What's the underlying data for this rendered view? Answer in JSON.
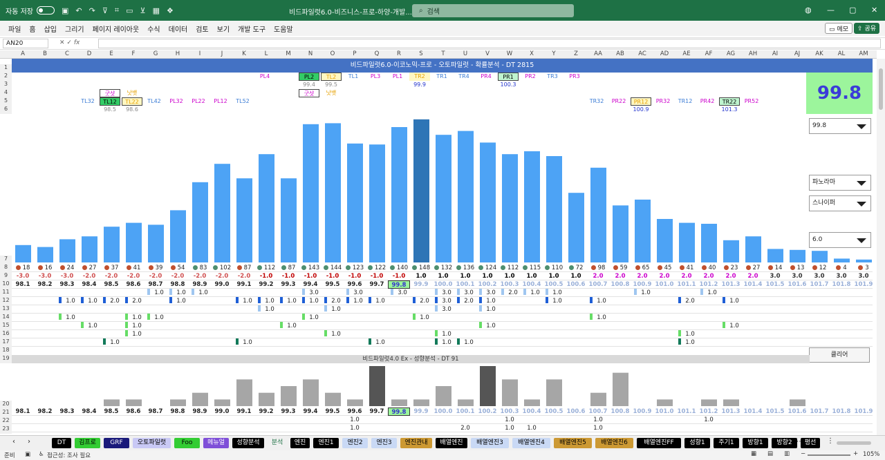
{
  "titlebar": {
    "autosave_label": "자동 저장",
    "autosave_state": "끔",
    "doc_title": "비드파일럿6.0-비즈니스-프로-하양-개발...",
    "search_placeholder": "검색",
    "colors": {
      "bg": "#1e7145"
    }
  },
  "menu": {
    "items": [
      "파일",
      "홈",
      "삽입",
      "그리기",
      "페이지 레이아웃",
      "수식",
      "데이터",
      "검토",
      "보기",
      "개발 도구",
      "도움말"
    ],
    "memo_label": "메모",
    "share_label": "공유"
  },
  "formula_bar": {
    "name_box": "AN20",
    "fx_label": "fx",
    "formula": ""
  },
  "columns": [
    "A",
    "B",
    "C",
    "D",
    "E",
    "F",
    "G",
    "H",
    "I",
    "J",
    "K",
    "L",
    "M",
    "N",
    "O",
    "P",
    "Q",
    "R",
    "S",
    "T",
    "U",
    "V",
    "W",
    "X",
    "Y",
    "Z",
    "AA",
    "AB",
    "AC",
    "AD",
    "AE",
    "AF",
    "AG",
    "AH",
    "AI",
    "AJ",
    "AK",
    "AL",
    "AM"
  ],
  "rows_top": [
    "1",
    "2",
    "3",
    "4",
    "5",
    "6",
    "7"
  ],
  "rows_grid": [
    "8",
    "9",
    "10",
    "11",
    "12",
    "13",
    "14",
    "15",
    "16",
    "17",
    "18",
    "19",
    "20",
    "21",
    "22",
    "23"
  ],
  "banner1": "비드파일럿6.0-이코노믹-프로 - 오토파일럿 - 확률분석 - DT 2815",
  "big_value": "99.8",
  "tiles": {
    "row2": [
      {
        "col": 11,
        "label": "PL4",
        "color": "#cc00cc"
      },
      {
        "col": 13,
        "label": "PL2",
        "color": "#000",
        "bg": "#33cc66",
        "box": true
      },
      {
        "col": 14,
        "label": "TL2",
        "color": "#e6a000",
        "bg": "#fff7c2",
        "box": true
      },
      {
        "col": 15,
        "label": "TL1",
        "color": "#3a7bd5"
      },
      {
        "col": 16,
        "label": "PL3",
        "color": "#cc00cc"
      },
      {
        "col": 17,
        "label": "PL1",
        "color": "#cc00cc"
      },
      {
        "col": 18,
        "label": "TR2",
        "color": "#e6a000",
        "bg": "#fff7c2"
      },
      {
        "col": 19,
        "label": "TR1",
        "color": "#3a7bd5"
      },
      {
        "col": 20,
        "label": "TR4",
        "color": "#3a7bd5"
      },
      {
        "col": 21,
        "label": "PR4",
        "color": "#cc00cc"
      },
      {
        "col": 22,
        "label": "PR1",
        "color": "#000",
        "bg": "#bff5cf",
        "box": true
      },
      {
        "col": 23,
        "label": "PR2",
        "color": "#cc00cc"
      },
      {
        "col": 24,
        "label": "TR3",
        "color": "#3a7bd5"
      },
      {
        "col": 25,
        "label": "PR3",
        "color": "#cc00cc"
      }
    ],
    "row3": [
      {
        "col": 13,
        "label": "99.4",
        "color": "#888"
      },
      {
        "col": 14,
        "label": "99.5",
        "color": "#888"
      },
      {
        "col": 18,
        "label": "99.9",
        "color": "#2233cc"
      },
      {
        "col": 22,
        "label": "100.3",
        "color": "#2233cc"
      }
    ],
    "row4": [
      {
        "col": 4,
        "label": "굿샷",
        "color": "#cc00cc",
        "box": true
      },
      {
        "col": 5,
        "label": "낫뱃",
        "color": "#e6a000"
      },
      {
        "col": 13,
        "label": "굿샷",
        "color": "#cc00cc",
        "box": true
      },
      {
        "col": 14,
        "label": "낫뱃",
        "color": "#e6a000"
      }
    ],
    "row5": [
      {
        "col": 3,
        "label": "TL32",
        "color": "#3a7bd5"
      },
      {
        "col": 4,
        "label": "TL12",
        "color": "#000",
        "bg": "#33cc66",
        "box": true
      },
      {
        "col": 5,
        "label": "TL22",
        "color": "#e6a000",
        "bg": "#fff7c2",
        "box": true
      },
      {
        "col": 6,
        "label": "TL42",
        "color": "#3a7bd5"
      },
      {
        "col": 7,
        "label": "PL32",
        "color": "#cc00cc"
      },
      {
        "col": 8,
        "label": "PL22",
        "color": "#cc00cc"
      },
      {
        "col": 9,
        "label": "PL12",
        "color": "#cc00cc"
      },
      {
        "col": 10,
        "label": "TL52",
        "color": "#3a7bd5"
      },
      {
        "col": 26,
        "label": "TR32",
        "color": "#3a7bd5"
      },
      {
        "col": 27,
        "label": "PR22",
        "color": "#cc00cc"
      },
      {
        "col": 28,
        "label": "PR12",
        "color": "#e6a000",
        "bg": "#fff7c2",
        "box": true
      },
      {
        "col": 29,
        "label": "PR32",
        "color": "#cc00cc"
      },
      {
        "col": 30,
        "label": "TR12",
        "color": "#3a7bd5"
      },
      {
        "col": 31,
        "label": "PR42",
        "color": "#cc00cc"
      },
      {
        "col": 32,
        "label": "TR22",
        "color": "#000",
        "bg": "#bff5cf",
        "box": true
      },
      {
        "col": 33,
        "label": "PR52",
        "color": "#cc00cc"
      }
    ],
    "row6": [
      {
        "col": 4,
        "label": "98.5",
        "color": "#888"
      },
      {
        "col": 5,
        "label": "98.6",
        "color": "#888"
      },
      {
        "col": 28,
        "label": "100.9",
        "color": "#2233cc"
      },
      {
        "col": 32,
        "label": "101.3",
        "color": "#2233cc"
      }
    ]
  },
  "dropdowns": [
    "99.8",
    "파노라마",
    "스나이퍼",
    "6.0"
  ],
  "chart_data": [
    {
      "type": "bar",
      "categories": [
        "98.1",
        "98.2",
        "98.3",
        "98.4",
        "98.5",
        "98.6",
        "98.7",
        "98.8",
        "98.9",
        "99.0",
        "99.1",
        "99.2",
        "99.3",
        "99.4",
        "99.5",
        "99.6",
        "99.7",
        "99.8",
        "99.9",
        "100.0",
        "100.1",
        "100.2",
        "100.3",
        "100.4",
        "100.5",
        "100.6",
        "100.7",
        "100.8",
        "100.9",
        "101.0",
        "101.1",
        "101.2",
        "101.3",
        "101.4",
        "101.5",
        "101.6",
        "101.7",
        "101.8",
        "101.9"
      ],
      "values": [
        18,
        16,
        24,
        27,
        37,
        41,
        39,
        54,
        83,
        102,
        87,
        112,
        87,
        143,
        144,
        123,
        122,
        140,
        148,
        132,
        136,
        124,
        112,
        115,
        110,
        72,
        98,
        59,
        65,
        45,
        41,
        40,
        23,
        27,
        14,
        13,
        12,
        4,
        3
      ],
      "highlight_index": 18,
      "ylim": [
        0,
        150
      ],
      "colors": {
        "bar": "#4da3f5",
        "highlight": "#2e75b6"
      }
    },
    {
      "type": "bar",
      "title": "비드파일럿4.0 Ex - 성향분석 - DT 91",
      "categories": [
        "98.1",
        "98.2",
        "98.3",
        "98.4",
        "98.5",
        "98.6",
        "98.7",
        "98.8",
        "98.9",
        "99.0",
        "99.1",
        "99.2",
        "99.3",
        "99.4",
        "99.5",
        "99.6",
        "99.7",
        "99.8",
        "99.9",
        "100.0",
        "100.1",
        "100.2",
        "100.3",
        "100.4",
        "100.5",
        "100.6",
        "100.7",
        "100.8",
        "100.9",
        "101.0",
        "101.1",
        "101.2",
        "101.3",
        "101.4",
        "101.5",
        "101.6",
        "101.7",
        "101.8",
        "101.9"
      ],
      "values": [
        0,
        0,
        0,
        0,
        1,
        1,
        0,
        1,
        2,
        1,
        4,
        2,
        3,
        4,
        2,
        1,
        6,
        1,
        1,
        3,
        1,
        6,
        4,
        1,
        4,
        0,
        2,
        5,
        0,
        1,
        0,
        1,
        1,
        0,
        0,
        1,
        0,
        0,
        0
      ],
      "dark_indices": [
        16,
        21
      ],
      "ylim": [
        0,
        6
      ],
      "colors": {
        "bar": "#a6a6a6",
        "dark": "#555555"
      }
    }
  ],
  "row8_counts": [
    "18",
    "16",
    "24",
    "27",
    "37",
    "41",
    "39",
    "54",
    "83",
    "102",
    "87",
    "112",
    "87",
    "143",
    "144",
    "123",
    "122",
    "140",
    "148",
    "132",
    "136",
    "124",
    "112",
    "115",
    "110",
    "72",
    "98",
    "59",
    "65",
    "45",
    "41",
    "40",
    "23",
    "27",
    "14",
    "13",
    "12",
    "4",
    "3"
  ],
  "row8_dot_colors": [
    "#c0502f",
    "#c0502f",
    "#c0502f",
    "#c0502f",
    "#c0502f",
    "#c0502f",
    "#c0502f",
    "#c0502f",
    "#4f8f6f",
    "#4f8f6f",
    "#c0502f",
    "#4f8f6f",
    "#4f8f6f",
    "#4f8f6f",
    "#4f8f6f",
    "#4f8f6f",
    "#4f8f6f",
    "#4f8f6f",
    "#4f8f6f",
    "#4f8f6f",
    "#4f8f6f",
    "#4f8f6f",
    "#4f8f6f",
    "#4f8f6f",
    "#4f8f6f",
    "#4f8f6f",
    "#c0502f",
    "#c0502f",
    "#c0502f",
    "#c0502f",
    "#c0502f",
    "#c0502f",
    "#c0502f",
    "#c0502f",
    "#c0502f",
    "#c0502f",
    "#c0502f",
    "#c0502f",
    "#c0502f"
  ],
  "row9_offsets": [
    "-3.0",
    "-3.0",
    "-3.0",
    "-2.0",
    "-2.0",
    "-2.0",
    "-2.0",
    "-2.0",
    "-2.0",
    "-2.0",
    "-2.0",
    "-1.0",
    "-1.0",
    "-1.0",
    "-1.0",
    "-1.0",
    "-1.0",
    "-1.0",
    "1.0",
    "1.0",
    "1.0",
    "1.0",
    "1.0",
    "1.0",
    "1.0",
    "1.0",
    "2.0",
    "2.0",
    "2.0",
    "2.0",
    "2.0",
    "2.0",
    "2.0",
    "2.0",
    "3.0",
    "3.0",
    "3.0",
    "3.0",
    "3.0"
  ],
  "row10_values": [
    "98.1",
    "98.2",
    "98.3",
    "98.4",
    "98.5",
    "98.6",
    "98.7",
    "98.8",
    "98.9",
    "99.0",
    "99.1",
    "99.2",
    "99.3",
    "99.4",
    "99.5",
    "99.6",
    "99.7",
    "99.8",
    "99.9",
    "100.0",
    "100.1",
    "100.2",
    "100.3",
    "100.4",
    "100.5",
    "100.6",
    "100.7",
    "100.8",
    "100.9",
    "101.0",
    "101.1",
    "101.2",
    "101.3",
    "101.4",
    "101.5",
    "101.6",
    "101.7",
    "101.8",
    "101.9"
  ],
  "grid_marks": [
    {
      "row": 11,
      "cells": [
        {
          "col": 6,
          "v": "1.0"
        },
        {
          "col": 7,
          "v": "1.0"
        },
        {
          "col": 8,
          "v": "1.0"
        },
        {
          "col": 13,
          "v": "3.0"
        },
        {
          "col": 15,
          "v": "3.0"
        },
        {
          "col": 17,
          "v": "3.0"
        },
        {
          "col": 19,
          "v": "3.0"
        },
        {
          "col": 20,
          "v": "3.0"
        },
        {
          "col": 21,
          "v": "3.0"
        },
        {
          "col": 22,
          "v": "2.0"
        },
        {
          "col": 23,
          "v": "1.0"
        },
        {
          "col": 24,
          "v": "1.0"
        },
        {
          "col": 28,
          "v": "1.0"
        },
        {
          "col": 31,
          "v": "1.0"
        }
      ]
    },
    {
      "row": 12,
      "cells": [
        {
          "col": 2,
          "v": "1.0"
        },
        {
          "col": 3,
          "v": "1.0"
        },
        {
          "col": 4,
          "v": "2.0"
        },
        {
          "col": 5,
          "v": "2.0"
        },
        {
          "col": 7,
          "v": "1.0"
        },
        {
          "col": 10,
          "v": "1.0"
        },
        {
          "col": 11,
          "v": "1.0"
        },
        {
          "col": 12,
          "v": "1.0"
        },
        {
          "col": 13,
          "v": "1.0"
        },
        {
          "col": 14,
          "v": "2.0"
        },
        {
          "col": 15,
          "v": "1.0"
        },
        {
          "col": 16,
          "v": "1.0"
        },
        {
          "col": 18,
          "v": "2.0"
        },
        {
          "col": 19,
          "v": "3.0"
        },
        {
          "col": 20,
          "v": "2.0"
        },
        {
          "col": 21,
          "v": "1.0"
        },
        {
          "col": 24,
          "v": "1.0"
        },
        {
          "col": 26,
          "v": "1.0"
        },
        {
          "col": 30,
          "v": "2.0"
        },
        {
          "col": 32,
          "v": "1.0"
        }
      ]
    },
    {
      "row": 13,
      "cells": [
        {
          "col": 11,
          "v": "1.0"
        },
        {
          "col": 14,
          "v": "1.0"
        },
        {
          "col": 19,
          "v": "3.0"
        },
        {
          "col": 21,
          "v": "1.0"
        }
      ]
    },
    {
      "row": 14,
      "cells": [
        {
          "col": 2,
          "v": "1.0"
        },
        {
          "col": 5,
          "v": "1.0"
        },
        {
          "col": 6,
          "v": "1.0"
        },
        {
          "col": 13,
          "v": "1.0"
        },
        {
          "col": 18,
          "v": "1.0"
        },
        {
          "col": 26,
          "v": "1.0"
        }
      ]
    },
    {
      "row": 15,
      "cells": [
        {
          "col": 3,
          "v": "1.0"
        },
        {
          "col": 5,
          "v": "1.0"
        },
        {
          "col": 12,
          "v": "1.0"
        },
        {
          "col": 21,
          "v": "1.0"
        },
        {
          "col": 32,
          "v": "1.0"
        }
      ]
    },
    {
      "row": 16,
      "cells": [
        {
          "col": 5,
          "v": "1.0"
        },
        {
          "col": 14,
          "v": "1.0"
        },
        {
          "col": 19,
          "v": "1.0"
        },
        {
          "col": 30,
          "v": "1.0"
        }
      ]
    },
    {
      "row": 17,
      "cells": [
        {
          "col": 4,
          "v": "1.0"
        },
        {
          "col": 10,
          "v": "1.0"
        },
        {
          "col": 16,
          "v": "1.0"
        },
        {
          "col": 19,
          "v": "1.0"
        },
        {
          "col": 20,
          "v": "1.0"
        },
        {
          "col": 30,
          "v": "1.0"
        }
      ]
    }
  ],
  "clear_button": "클리어",
  "banner2": "비드파일럿4.0 Ex - 성향분석 - DT 91",
  "row21_values": [
    "98.1",
    "98.2",
    "98.3",
    "98.4",
    "98.5",
    "98.6",
    "98.7",
    "98.8",
    "98.9",
    "99.0",
    "99.1",
    "99.2",
    "99.3",
    "99.4",
    "99.5",
    "99.6",
    "99.7",
    "99.8",
    "99.9",
    "100.0",
    "100.1",
    "100.2",
    "100.3",
    "100.4",
    "100.5",
    "100.6",
    "100.7",
    "100.8",
    "100.9",
    "101.0",
    "101.1",
    "101.2",
    "101.3",
    "101.4",
    "101.5",
    "101.6",
    "101.7",
    "101.8",
    "101.9"
  ],
  "row22_marks": [
    {
      "col": 15,
      "v": "1.0"
    },
    {
      "col": 22,
      "v": "1.0"
    },
    {
      "col": 26,
      "v": "1.0"
    },
    {
      "col": 31,
      "v": "1.0"
    }
  ],
  "row23_marks": [
    {
      "col": 15,
      "v": "1.0"
    },
    {
      "col": 20,
      "v": "2.0"
    },
    {
      "col": 22,
      "v": "1.0"
    },
    {
      "col": 23,
      "v": "1.0"
    },
    {
      "col": 26,
      "v": "1.0"
    }
  ],
  "sheet_tabs": [
    {
      "label": "DT",
      "bg": "#000",
      "fg": "#fff"
    },
    {
      "label": "김프로",
      "bg": "#33cc33",
      "fg": "#000"
    },
    {
      "label": "GRF",
      "bg": "#1a1a7a",
      "fg": "#fff"
    },
    {
      "label": "오토파일럿",
      "bg": "#c9c9f5",
      "fg": "#000"
    },
    {
      "label": "Foo",
      "bg": "#33cc33",
      "fg": "#000"
    },
    {
      "label": "메뉴얼",
      "bg": "#7f4fd8",
      "fg": "#fff"
    },
    {
      "label": "성향분석",
      "bg": "#000",
      "fg": "#fff"
    },
    {
      "label": "분석",
      "bg": "#f0f0f0",
      "fg": "#1e7145"
    },
    {
      "label": "엔진",
      "bg": "#000",
      "fg": "#fff"
    },
    {
      "label": "엔진1",
      "bg": "#000",
      "fg": "#fff"
    },
    {
      "label": "엔진2",
      "bg": "#c9d9f5",
      "fg": "#000"
    },
    {
      "label": "엔진3",
      "bg": "#c9d9f5",
      "fg": "#000"
    },
    {
      "label": "엔진관내",
      "bg": "#cc9933",
      "fg": "#000"
    },
    {
      "label": "배열엔진",
      "bg": "#000",
      "fg": "#fff"
    },
    {
      "label": "배열엔진3",
      "bg": "#c9d9f5",
      "fg": "#000"
    },
    {
      "label": "배열엔진4",
      "bg": "#c9d9f5",
      "fg": "#000"
    },
    {
      "label": "배열엔진5",
      "bg": "#cc9933",
      "fg": "#000"
    },
    {
      "label": "배열엔진6",
      "bg": "#cc9933",
      "fg": "#000"
    },
    {
      "label": "배열엔진FF",
      "bg": "#000",
      "fg": "#fff"
    },
    {
      "label": "성향1",
      "bg": "#000",
      "fg": "#fff"
    },
    {
      "label": "주기1",
      "bg": "#000",
      "fg": "#fff"
    },
    {
      "label": "방향1",
      "bg": "#000",
      "fg": "#fff"
    },
    {
      "label": "방향2",
      "bg": "#000",
      "fg": "#fff"
    },
    {
      "label": "평선",
      "bg": "#000",
      "fg": "#fff"
    }
  ],
  "status": {
    "ready": "준비",
    "accessibility": "접근성: 조사 필요",
    "zoom": "105%"
  }
}
